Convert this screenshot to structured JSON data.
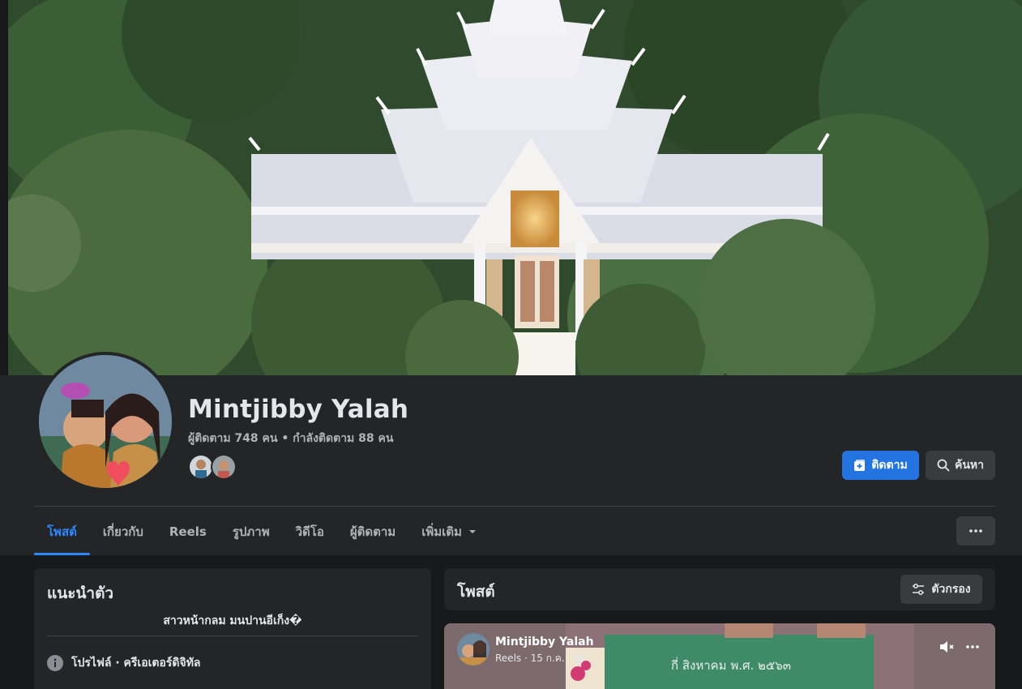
{
  "profile": {
    "name": "Mintjibby Yalah",
    "stats": "ผู้ติดตาม 748 คน • กำลังติดตาม 88 คน"
  },
  "actions": {
    "follow_label": "ติดตาม",
    "search_label": "ค้นหา"
  },
  "tabs": [
    {
      "label": "โพสต์",
      "active": true
    },
    {
      "label": "เกี่ยวกับ"
    },
    {
      "label": "Reels"
    },
    {
      "label": "รูปภาพ"
    },
    {
      "label": "วิดีโอ"
    },
    {
      "label": "ผู้ติดตาม"
    },
    {
      "label": "เพิ่มเติม"
    }
  ],
  "intro": {
    "title": "แนะนำตัว",
    "bio": "สาวหน้ากลม มนปานอีเก็ง�",
    "profile_line": "โปรไฟล์ · ครีเอเตอร์ดิจิทัล"
  },
  "posts": {
    "title": "โพสต์",
    "filter_label": "ตัวกรอง",
    "first": {
      "author": "Mintjibby Yalah",
      "meta": "Reels · 15 ก.ค. ·",
      "board_text": "กี่ สิงหาคม พ.ศ. ๒๕๖๓"
    }
  },
  "colors": {
    "accent": "#2374e1",
    "tab_active": "#2d88ff",
    "background": "#18191a",
    "card": "#242526"
  }
}
